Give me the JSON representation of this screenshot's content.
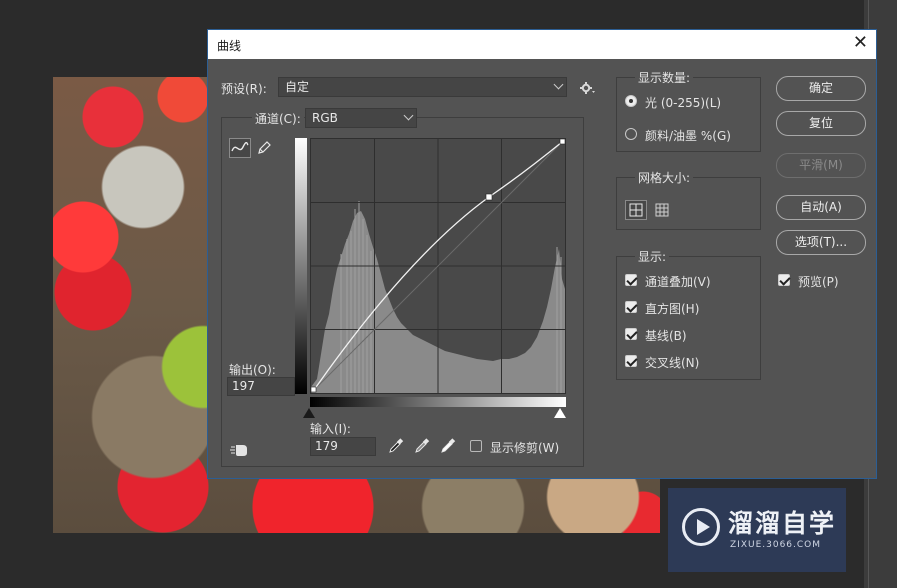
{
  "dialog": {
    "title": "曲线",
    "close_icon": "close-icon"
  },
  "preset": {
    "label": "预设(R):",
    "value": "自定",
    "gear_icon": "gear-icon"
  },
  "channel": {
    "label": "通道(C):",
    "value": "RGB"
  },
  "tools": {
    "curve_icon": "curve-tool-icon",
    "pencil_icon": "pencil-icon",
    "hand_icon": "target-adjust-icon"
  },
  "output": {
    "label": "输出(O):",
    "value": "197"
  },
  "input": {
    "label": "输入(I):",
    "value": "179"
  },
  "eyedroppers": [
    "black-eyedropper-icon",
    "gray-eyedropper-icon",
    "white-eyedropper-icon"
  ],
  "show_clipping": {
    "label": "显示修剪(W)",
    "checked": false
  },
  "display_amount": {
    "title": "显示数量:",
    "options": [
      {
        "label": "光 (0-255)(L)",
        "selected": true
      },
      {
        "label": "颜料/油墨 %(G)",
        "selected": false
      }
    ]
  },
  "grid_size": {
    "title": "网格大小:",
    "icons": [
      "grid-coarse-icon",
      "grid-fine-icon"
    ]
  },
  "display": {
    "title": "显示:",
    "options": [
      {
        "label": "通道叠加(V)",
        "checked": true
      },
      {
        "label": "直方图(H)",
        "checked": true
      },
      {
        "label": "基线(B)",
        "checked": true
      },
      {
        "label": "交叉线(N)",
        "checked": true
      }
    ]
  },
  "buttons": {
    "ok": "确定",
    "reset": "复位",
    "smooth": "平滑(M)",
    "auto": "自动(A)",
    "options": "选项(T)..."
  },
  "preview": {
    "label": "预览(P)",
    "checked": true
  },
  "watermark": {
    "title": "溜溜自学",
    "subtitle": "ZIXUE.3066.COM"
  },
  "colors": {
    "dialog_bg": "#535353",
    "titlebar_bg": "#ffffff",
    "accent_border": "#2c5e94"
  }
}
